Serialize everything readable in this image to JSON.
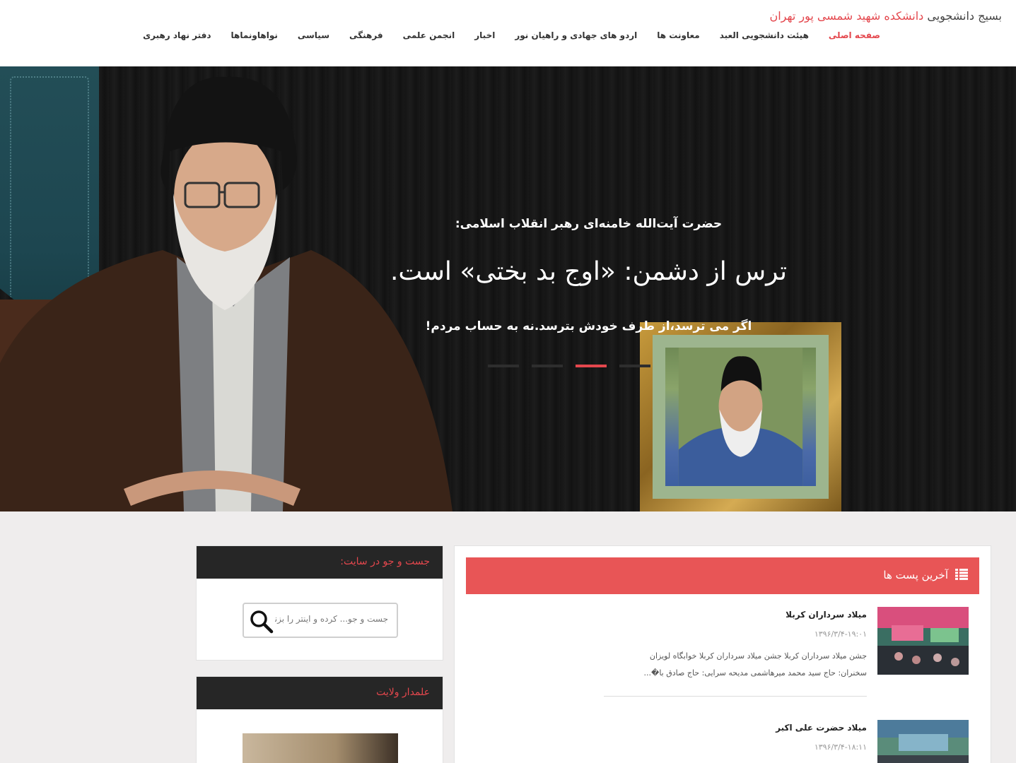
{
  "header": {
    "site_title_plain": "بسیج دانشجویی ",
    "site_title_highlight": "دانشکده شهید شمسی پور تهران",
    "nav": [
      {
        "label": "صفحه اصلی",
        "active": true
      },
      {
        "label": "هیئت دانشجویی العبد"
      },
      {
        "label": "معاونت ها"
      },
      {
        "label": "اردو های جهادی و راهیان نور"
      },
      {
        "label": "اخبار"
      },
      {
        "label": "انجمن علمی"
      },
      {
        "label": "فرهنگی"
      },
      {
        "label": "سیاسی"
      },
      {
        "label": "نواهاونماها"
      },
      {
        "label": "دفتر نهاد رهبری"
      }
    ]
  },
  "hero": {
    "subtitle": "حضرت آیت‌الله خامنه‌ای رهبر انقلاب اسلامی:",
    "headline": "ترس از دشمن: «اوج بد بختی» است.",
    "line": "اگر می ترسد،از طرف خودش بترسد.نه به حساب مردم!",
    "slides_count": 4,
    "active_slide": 3
  },
  "latest_posts": {
    "title": "آخرین پست ها",
    "icon": "list-icon",
    "items": [
      {
        "title": "میلاد سرداران کربلا",
        "date": "۱۳۹۶/۳/۴-۱۹:۰۱",
        "excerpt": "جشن میلاد سرداران کربلا  جشن میلاد سرداران کربلا  خوابگاه لویزان سخنران: حاج سید محمد میرهاشمی مدیحه سرایی: حاج صادق با�..."
      },
      {
        "title": "میلاد حضرت علی اکبر",
        "date": "۱۳۹۶/۳/۴-۱۸:۱۱",
        "excerpt": ""
      }
    ]
  },
  "sidebar": {
    "search_widget_title": "جست و جو در سایت:",
    "search_placeholder": "جست و جو... کرده و اینتر را بزنید",
    "leader_widget_title": "علمدار ولایت"
  },
  "colors": {
    "accent": "#e4474d",
    "header_bar": "#e85556",
    "widget_head": "#262626"
  }
}
